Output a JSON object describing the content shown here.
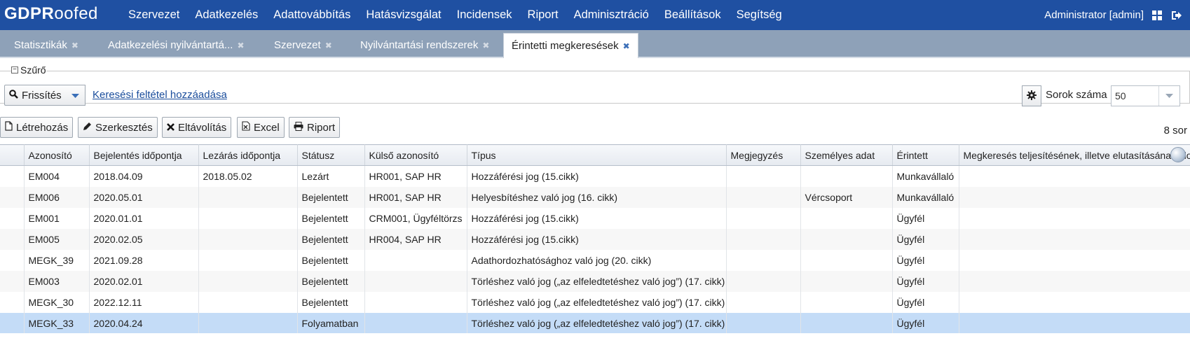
{
  "app": {
    "logo_bold": "GDPR",
    "logo_rest": "oofed",
    "nav": [
      "Szervezet",
      "Adatkezelés",
      "Adattovábbítás",
      "Hatásvizsgálat",
      "Incidensek",
      "Riport",
      "Adminisztráció",
      "Beállítások",
      "Segítség"
    ],
    "user": "Administrator [admin]",
    "colors": {
      "topbar": "#1f50a2",
      "tabbar": "#8ea1b8",
      "selected_row": "#c4dcf7"
    }
  },
  "tabs": [
    {
      "label": "Statisztikák",
      "close": "✖"
    },
    {
      "label": "Adatkezelési nyilvántartá...",
      "close": "✖"
    },
    {
      "label": "Szervezet",
      "close": "✖"
    },
    {
      "label": "Nyilvántartási rendszerek",
      "close": "✖"
    },
    {
      "label": "Érintetti megkeresések",
      "close": "✖"
    }
  ],
  "filter": {
    "legend": "Szűrő",
    "collapse_symbol": "−",
    "refresh_label": "Frissítés",
    "add_condition_link": "Keresési feltétel hozzáadása",
    "rows_label": "Sorok száma",
    "rows_value": "50"
  },
  "toolbar": {
    "create": "Létrehozás",
    "edit": "Szerkesztés",
    "remove": "Eltávolítás",
    "excel": "Excel",
    "report": "Riport",
    "row_count": "8 sor"
  },
  "table": {
    "columns": [
      "Azonosító",
      "Bejelentés időpontja",
      "Lezárás időpontja",
      "Státusz",
      "Külső azonosító",
      "Típus",
      "Megjegyzés",
      "Személyes adat",
      "Érintett",
      "Megkeresés teljesítésének, illetve elutasításának ido"
    ],
    "rows": [
      [
        "EM004",
        "2018.04.09",
        "2018.05.02",
        "Lezárt",
        "HR001, SAP HR",
        "Hozzáférési jog (15.cikk)",
        "",
        "",
        "Munkavállaló",
        ""
      ],
      [
        "EM006",
        "2020.05.01",
        "",
        "Bejelentett",
        "HR001, SAP HR",
        "Helyesbítéshez való jog (16. cikk)",
        "",
        "Vércsoport",
        "Munkavállaló",
        ""
      ],
      [
        "EM001",
        "2020.01.01",
        "",
        "Bejelentett",
        "CRM001, Ügyféltörzs",
        "Hozzáférési jog (15.cikk)",
        "",
        "",
        "Ügyfél",
        ""
      ],
      [
        "EM005",
        "2020.02.05",
        "",
        "Bejelentett",
        "HR004, SAP HR",
        "Hozzáférési jog (15.cikk)",
        "",
        "",
        "Ügyfél",
        ""
      ],
      [
        "MEGK_39",
        "2021.09.28",
        "",
        "Bejelentett",
        "",
        "Adathordozhatósághoz való jog (20. cikk)",
        "",
        "",
        "Ügyfél",
        ""
      ],
      [
        "EM003",
        "2020.02.01",
        "",
        "Bejelentett",
        "",
        "Törléshez való jog („az elfeledtetéshez való jog”) (17. cikk)",
        "",
        "",
        "Ügyfél",
        ""
      ],
      [
        "MEGK_30",
        "2022.12.11",
        "",
        "Bejelentett",
        "",
        "Törléshez való jog („az elfeledtetéshez való jog”) (17. cikk)",
        "",
        "",
        "Ügyfél",
        ""
      ],
      [
        "MEGK_33",
        "2020.04.24",
        "",
        "Folyamatban",
        "",
        "Törléshez való jog („az elfeledtetéshez való jog”) (17. cikk)",
        "",
        "",
        "Ügyfél",
        ""
      ]
    ],
    "selected_row": 7
  }
}
